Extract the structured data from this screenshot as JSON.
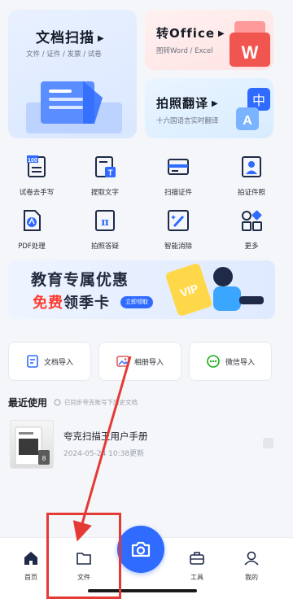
{
  "cards": {
    "scan": {
      "title": "文档扫描",
      "sub": "文件 / 证件 / 发票 / 试卷"
    },
    "office": {
      "title": "转Office",
      "sub": "图转Word / Excel",
      "badge": "W"
    },
    "translate": {
      "title": "拍照翻译",
      "sub": "十六国语言实时翻译",
      "badge_a": "A",
      "badge_b": "中"
    }
  },
  "tools": [
    {
      "label": "试卷去手写",
      "icon": "exam-icon"
    },
    {
      "label": "提取文字",
      "icon": "extract-text-icon"
    },
    {
      "label": "扫描证件",
      "icon": "id-scan-icon"
    },
    {
      "label": "拍证件照",
      "icon": "id-photo-icon"
    },
    {
      "label": "PDF处理",
      "icon": "pdf-icon"
    },
    {
      "label": "拍照答疑",
      "icon": "pi-icon"
    },
    {
      "label": "智能消除",
      "icon": "magic-wand-icon"
    },
    {
      "label": "更多",
      "icon": "more-apps-icon"
    }
  ],
  "banner": {
    "line1": "教育专属优惠",
    "line2_red": "免费",
    "line2_rest": "领季卡",
    "button": "立即领取",
    "vip": "VIP"
  },
  "imports": [
    {
      "label": "文档导入",
      "icon": "doc-import-icon"
    },
    {
      "label": "相册导入",
      "icon": "album-import-icon"
    },
    {
      "label": "微信导入",
      "icon": "wechat-import-icon"
    }
  ],
  "recent": {
    "title": "最近使用",
    "sync": "已同步夸克账号下历史文档"
  },
  "file": {
    "name": "夸克扫描王用户手册",
    "date": "2024-05-24 10:38更新",
    "pages": "8"
  },
  "nav": {
    "home": "首页",
    "files": "文件",
    "tools": "工具",
    "mine": "我的"
  },
  "colors": {
    "accent": "#2f6bff",
    "annotation": "#e53935",
    "promo_red": "#ff3b30"
  }
}
